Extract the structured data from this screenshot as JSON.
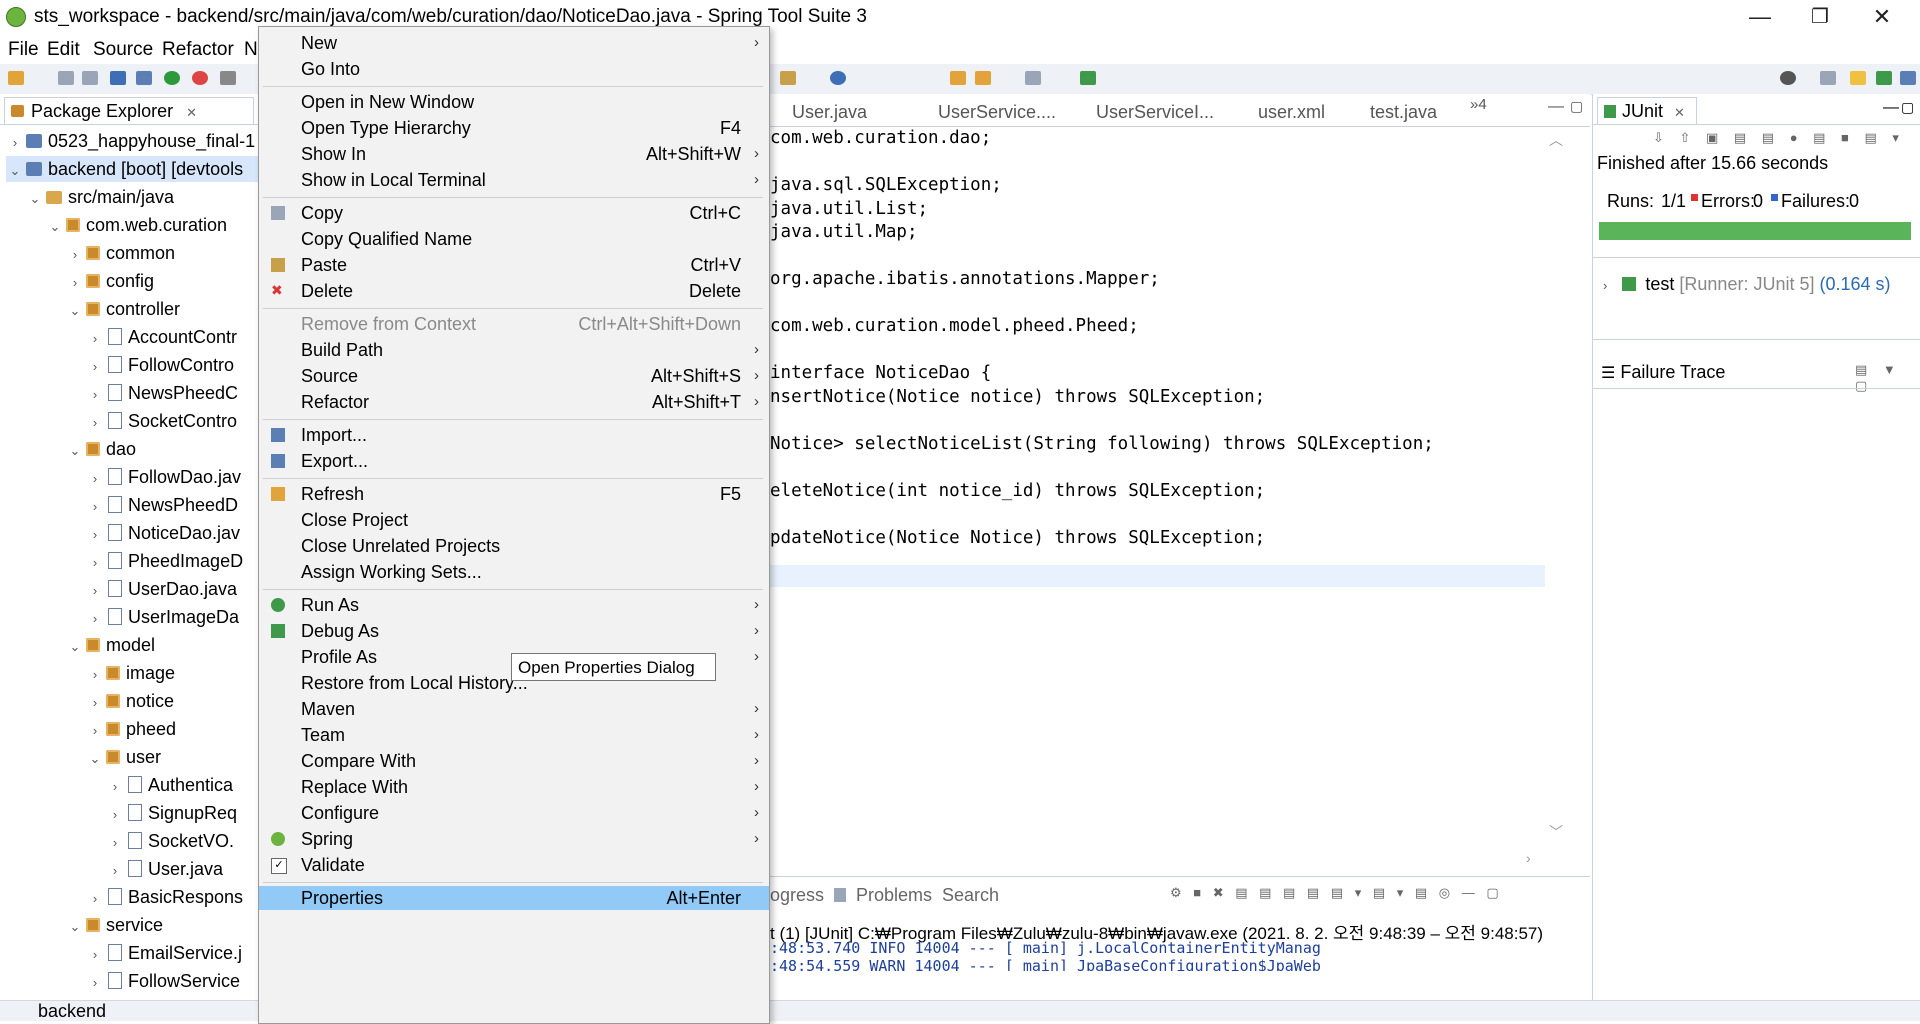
{
  "window": {
    "title": "sts_workspace - backend/src/main/java/com/web/curation/dao/NoticeDao.java - Spring Tool Suite 3",
    "min": "—",
    "max": "❐",
    "close": "✕"
  },
  "menubar": [
    "File",
    "Edit",
    "Source",
    "Refactor",
    "N"
  ],
  "package_explorer": {
    "title": "Package Explorer",
    "rows": [
      {
        "indent": 0,
        "tw": "›",
        "icon": "proj",
        "label": "0523_happyhouse_final-1"
      },
      {
        "indent": 0,
        "tw": "⌄",
        "icon": "proj",
        "label": "backend [boot] [devtools"
      },
      {
        "indent": 1,
        "tw": "⌄",
        "icon": "folder",
        "label": "src/main/java"
      },
      {
        "indent": 2,
        "tw": "⌄",
        "icon": "pkg",
        "label": "com.web.curation"
      },
      {
        "indent": 3,
        "tw": "›",
        "icon": "pkg",
        "label": "common"
      },
      {
        "indent": 3,
        "tw": "›",
        "icon": "pkg",
        "label": "config"
      },
      {
        "indent": 3,
        "tw": "⌄",
        "icon": "pkg",
        "label": "controller"
      },
      {
        "indent": 4,
        "tw": "›",
        "icon": "jfile",
        "label": "AccountContr"
      },
      {
        "indent": 4,
        "tw": "›",
        "icon": "jfile",
        "label": "FollowContro"
      },
      {
        "indent": 4,
        "tw": "›",
        "icon": "jfile",
        "label": "NewsPheedC"
      },
      {
        "indent": 4,
        "tw": "›",
        "icon": "jfile",
        "label": "SocketContro"
      },
      {
        "indent": 3,
        "tw": "⌄",
        "icon": "pkg",
        "label": "dao"
      },
      {
        "indent": 4,
        "tw": "›",
        "icon": "jfile",
        "label": "FollowDao.jav"
      },
      {
        "indent": 4,
        "tw": "›",
        "icon": "jfile",
        "label": "NewsPheedD"
      },
      {
        "indent": 4,
        "tw": "›",
        "icon": "jfile",
        "label": "NoticeDao.jav"
      },
      {
        "indent": 4,
        "tw": "›",
        "icon": "jfile",
        "label": "PheedImageD"
      },
      {
        "indent": 4,
        "tw": "›",
        "icon": "jfile",
        "label": "UserDao.java"
      },
      {
        "indent": 4,
        "tw": "›",
        "icon": "jfile",
        "label": "UserImageDa"
      },
      {
        "indent": 3,
        "tw": "⌄",
        "icon": "pkg",
        "label": "model"
      },
      {
        "indent": 4,
        "tw": "›",
        "icon": "pkg",
        "label": "image"
      },
      {
        "indent": 4,
        "tw": "›",
        "icon": "pkg",
        "label": "notice"
      },
      {
        "indent": 4,
        "tw": "›",
        "icon": "pkg",
        "label": "pheed"
      },
      {
        "indent": 4,
        "tw": "⌄",
        "icon": "pkg",
        "label": "user"
      },
      {
        "indent": 5,
        "tw": "›",
        "icon": "jfile",
        "label": "Authentica"
      },
      {
        "indent": 5,
        "tw": "›",
        "icon": "jfile",
        "label": "SignupReq"
      },
      {
        "indent": 5,
        "tw": "›",
        "icon": "jfile",
        "label": "SocketVO."
      },
      {
        "indent": 5,
        "tw": "›",
        "icon": "jfile",
        "label": "User.java"
      },
      {
        "indent": 4,
        "tw": "›",
        "icon": "jfile",
        "label": "BasicRespons"
      },
      {
        "indent": 3,
        "tw": "⌄",
        "icon": "pkg",
        "label": "service"
      },
      {
        "indent": 4,
        "tw": "›",
        "icon": "jfile",
        "label": "EmailService.j"
      },
      {
        "indent": 4,
        "tw": "›",
        "icon": "jfile",
        "label": "FollowService"
      }
    ]
  },
  "editor": {
    "tabs": [
      "User.java",
      "UserService....",
      "UserServiceI...",
      "user.xml",
      "test.java"
    ],
    "overflow": "»4",
    "lines": [
      "com.web.curation.dao;",
      "",
      "java.sql.SQLException;",
      "java.util.List;",
      "java.util.Map;",
      "",
      "org.apache.ibatis.annotations.Mapper;",
      "",
      "com.web.curation.model.pheed.Pheed;",
      "",
      "interface NoticeDao {",
      "nsertNotice(Notice notice) throws SQLException;",
      "",
      "Notice> selectNoticeList(String following) throws SQLException;",
      "",
      "eleteNotice(int notice_id) throws SQLException;",
      "",
      "pdateNotice(Notice Notice) throws SQLException;"
    ]
  },
  "console": {
    "tabs": [
      "ogress",
      "Problems",
      "Search"
    ],
    "header": "t (1) [JUnit] C:₩Program Files₩Zulu₩zulu-8₩bin₩javaw.exe  (2021. 8. 2. 오전 9:48:39 – 오전 9:48:57)",
    "line1": ":48:53.740  INFO 14004 ---  [           main] j.LocalContainerEntityManag",
    "line2": ":48:54.559  WARN 14004 ---  [           main] JpaBaseConfiguration$JpaWeb"
  },
  "junit": {
    "title": "JUnit",
    "finished": "Finished after 15.66 seconds",
    "runs_label": "Runs:",
    "runs": "1/1",
    "errors_label": "Errors:",
    "errors": "0",
    "failures_label": "Failures:",
    "failures": "0",
    "progress": 1.0,
    "test_name": "test",
    "test_runner": "[Runner: JUnit 5]",
    "test_time": "(0.164 s)",
    "failure_trace": "Failure Trace",
    "bar_color": "#5ab55a"
  },
  "status": "backend",
  "context_menu": {
    "items": [
      {
        "label": "New",
        "acc": "",
        "arrow": true
      },
      {
        "label": "Go Into",
        "acc": ""
      },
      {
        "sep": true
      },
      {
        "label": "Open in New Window",
        "acc": ""
      },
      {
        "label": "Open Type Hierarchy",
        "acc": "F4"
      },
      {
        "label": "Show In",
        "acc": "Alt+Shift+W",
        "arrow": true
      },
      {
        "label": "Show in Local Terminal",
        "acc": "",
        "arrow": true
      },
      {
        "sep": true
      },
      {
        "label": "Copy",
        "acc": "Ctrl+C",
        "icon": "copy-icon"
      },
      {
        "label": "Copy Qualified Name",
        "acc": ""
      },
      {
        "label": "Paste",
        "acc": "Ctrl+V",
        "icon": "paste-icon"
      },
      {
        "label": "Delete",
        "acc": "Delete",
        "icon": "delete-icon"
      },
      {
        "sep": true
      },
      {
        "label": "Remove from Context",
        "acc": "Ctrl+Alt+Shift+Down",
        "disabled": true
      },
      {
        "label": "Build Path",
        "acc": "",
        "arrow": true
      },
      {
        "label": "Source",
        "acc": "Alt+Shift+S",
        "arrow": true
      },
      {
        "label": "Refactor",
        "acc": "Alt+Shift+T",
        "arrow": true
      },
      {
        "sep": true
      },
      {
        "label": "Import...",
        "acc": "",
        "icon": "import-icon"
      },
      {
        "label": "Export...",
        "acc": "",
        "icon": "export-icon"
      },
      {
        "sep": true
      },
      {
        "label": "Refresh",
        "acc": "F5",
        "icon": "refresh-icon"
      },
      {
        "label": "Close Project",
        "acc": ""
      },
      {
        "label": "Close Unrelated Projects",
        "acc": ""
      },
      {
        "label": "Assign Working Sets...",
        "acc": ""
      },
      {
        "sep": true
      },
      {
        "label": "Run As",
        "acc": "",
        "arrow": true,
        "icon": "run-icon"
      },
      {
        "label": "Debug As",
        "acc": "",
        "arrow": true,
        "icon": "debug-icon"
      },
      {
        "label": "Profile As",
        "acc": "",
        "arrow": true
      },
      {
        "label": "Restore from Local History...",
        "acc": ""
      },
      {
        "label": "Maven",
        "acc": "",
        "arrow": true
      },
      {
        "label": "Team",
        "acc": "",
        "arrow": true
      },
      {
        "label": "Compare With",
        "acc": "",
        "arrow": true
      },
      {
        "label": "Replace With",
        "acc": "",
        "arrow": true
      },
      {
        "label": "Configure",
        "acc": "",
        "arrow": true
      },
      {
        "label": "Spring",
        "acc": "",
        "arrow": true,
        "icon": "spring-icon"
      },
      {
        "label": "Validate",
        "acc": "",
        "icon": "validate-icon"
      },
      {
        "sep": true
      },
      {
        "label": "Properties",
        "acc": "Alt+Enter",
        "selected": true
      }
    ],
    "tooltip": "Open Properties Dialog"
  }
}
